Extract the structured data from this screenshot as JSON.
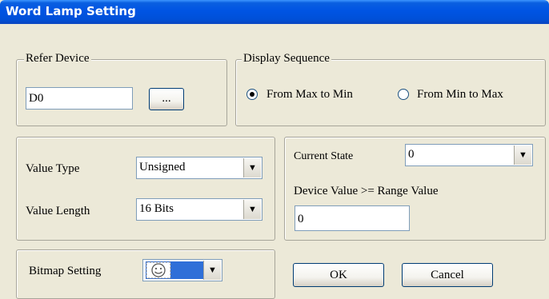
{
  "window": {
    "title": "Word Lamp Setting"
  },
  "refer_device": {
    "legend": "Refer Device",
    "value": "D0",
    "browse_label": "..."
  },
  "display_sequence": {
    "legend": "Display Sequence",
    "options": [
      {
        "label": "From Max to Min",
        "selected": true
      },
      {
        "label": "From Min to Max",
        "selected": false
      }
    ]
  },
  "value_settings": {
    "type_label": "Value Type",
    "type_value": "Unsigned",
    "length_label": "Value Length",
    "length_value": "16 Bits"
  },
  "state": {
    "current_state_label": "Current State",
    "current_state_value": "0",
    "device_value_label": "Device Value >= Range Value",
    "device_value": "0"
  },
  "bitmap": {
    "label": "Bitmap Setting",
    "icon": "smiley-bitmap-icon"
  },
  "buttons": {
    "ok": "OK",
    "cancel": "Cancel"
  },
  "colors": {
    "titlebar": "#0054e3",
    "face": "#ece9d8",
    "bitmap_swatch": "#2f6fd8"
  }
}
